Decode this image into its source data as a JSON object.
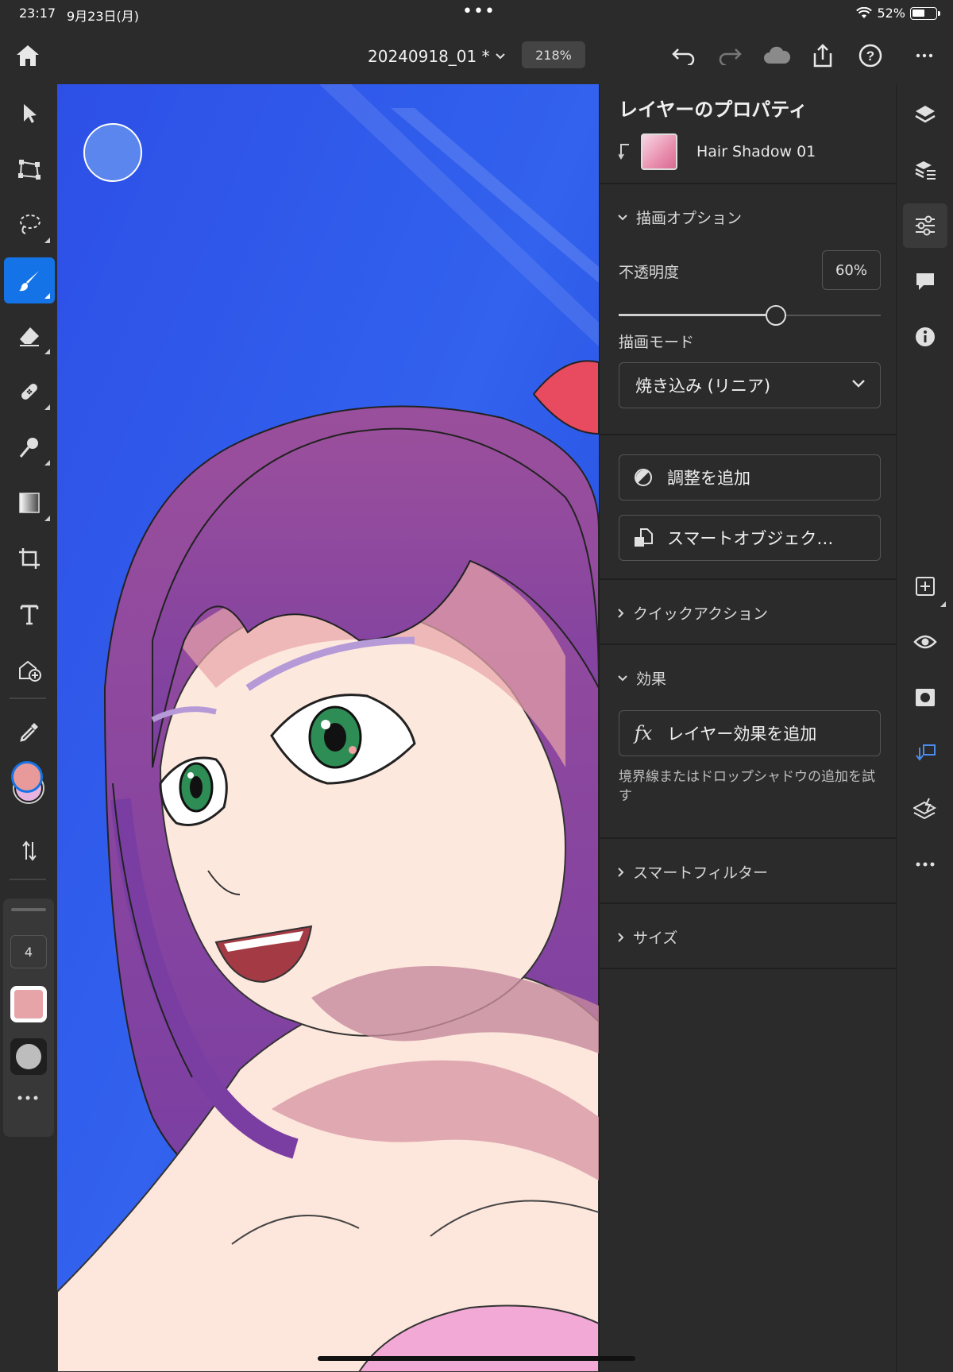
{
  "status_bar": {
    "time": "23:17",
    "date": "9月23日(月)",
    "battery": "52%",
    "battery_level": 0.52
  },
  "toolbar": {
    "document_title": "20240918_01 *",
    "zoom": "218%"
  },
  "tools": {
    "brush_size": "4",
    "foreground_color": "#e89a9a",
    "background_color": "#e5b3dd",
    "brush_preview_color": "#e6a3a8"
  },
  "panel": {
    "title": "レイヤーのプロパティ",
    "layer_name": "Hair Shadow 01",
    "draw_options": "描画オプション",
    "opacity_label": "不透明度",
    "opacity_value": "60%",
    "opacity": 0.6,
    "blend_mode_label": "描画モード",
    "blend_mode": "焼き込み (リニア)",
    "add_adjustment": "調整を追加",
    "smart_object": "スマートオブジェク…",
    "quick_actions": "クイックアクション",
    "effects": "効果",
    "add_layer_effect": "レイヤー効果を追加",
    "effects_hint": "境界線またはドロップシャドウの追加を試す",
    "smart_filters": "スマートフィルター",
    "size": "サイズ"
  },
  "colors": {
    "accent": "#1473e6",
    "canvas_sky": "#2a52e8"
  }
}
